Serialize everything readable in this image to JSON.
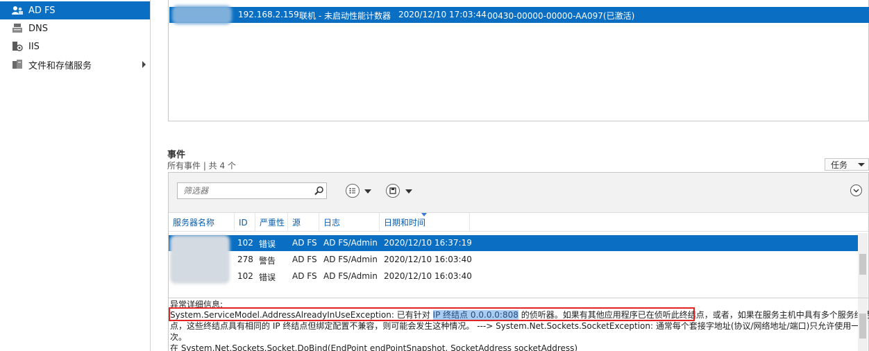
{
  "nav": {
    "items": [
      {
        "label": "AD FS",
        "icon": "adfs-users-icon",
        "selected": true
      },
      {
        "label": "DNS",
        "icon": "dns-server-icon",
        "selected": false
      },
      {
        "label": "IIS",
        "icon": "iis-icon",
        "selected": false
      },
      {
        "label": "文件和存储服务",
        "icon": "file-storage-icon",
        "selected": false,
        "has_submenu": true
      }
    ]
  },
  "servers": {
    "row": {
      "ip": "192.168.2.159",
      "status": "联机 - 未启动性能计数器",
      "timestamp": "2020/12/10 17:03:44",
      "product_id": "00430-00000-00000-AA097(已激活)"
    }
  },
  "events": {
    "title": "事件",
    "subtitle": "所有事件 | 共 4 个",
    "tasks_label": "任务",
    "filter_placeholder": "筛选器",
    "columns": [
      "服务器名称",
      "ID",
      "严重性",
      "源",
      "日志",
      "日期和时间"
    ],
    "rows": [
      {
        "id": "102",
        "severity": "错误",
        "source": "AD FS",
        "log": "AD FS/Admin",
        "datetime": "2020/12/10 16:37:19",
        "selected": true
      },
      {
        "id": "278",
        "severity": "警告",
        "source": "AD FS",
        "log": "AD FS/Admin",
        "datetime": "2020/12/10 16:03:40",
        "selected": false
      },
      {
        "id": "102",
        "severity": "错误",
        "source": "AD FS",
        "log": "AD FS/Admin",
        "datetime": "2020/12/10 16:03:40",
        "selected": false
      }
    ]
  },
  "detail": {
    "label": "异常详细信息:",
    "line1_prefix": "System.ServiceModel.AddressAlreadyInUseException: 已有针对",
    "line1_highlight": "IP 终结点 0.0.0.0:808",
    "line1_suffix": "的侦听器。如果有其他应用程序已在侦听此终结点，或者，如果在服务主机中具有多个服务终结",
    "line2": "点，这些终结点具有相同的 IP 终结点但绑定配置不兼容，则可能会发生这种情况。 ---> System.Net.Sockets.SocketException: 通常每个套接字地址(协议/网络地址/端口)只允许使用一",
    "line3": "次。",
    "line4": "   在 System.Net.Sockets.Socket.DoBind(EndPoint endPointSnapshot, SocketAddress socketAddress)"
  },
  "colors": {
    "selection": "#0a6fc2",
    "highlight_box": "#e32222",
    "link_header": "#0a5fb0"
  }
}
